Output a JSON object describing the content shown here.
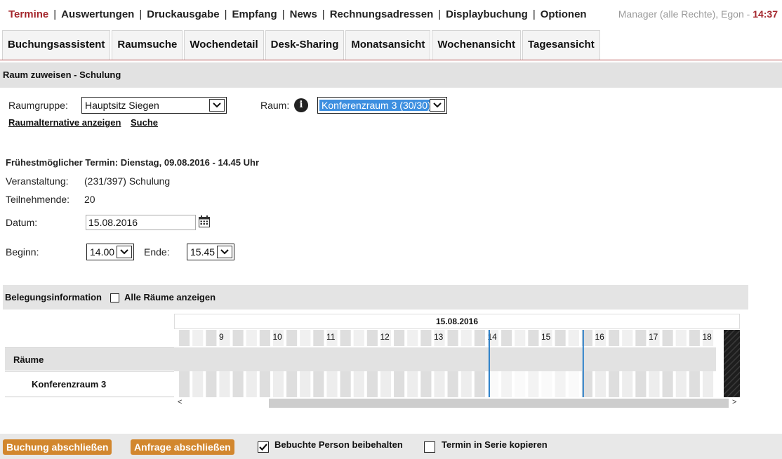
{
  "topnav": {
    "items": [
      "Termine",
      "Auswertungen",
      "Druckausgabe",
      "Empfang",
      "News",
      "Rechnungsadressen",
      "Displaybuchung",
      "Optionen"
    ],
    "user": "Manager (alle Rechte), Egon - ",
    "time": "14:37"
  },
  "tabs": [
    "Buchungsassistent",
    "Raumsuche",
    "Wochendetail",
    "Desk-Sharing",
    "Monatsansicht",
    "Wochenansicht",
    "Tagesansicht"
  ],
  "section": {
    "title": "Raum zuweisen - Schulung"
  },
  "form": {
    "raumgruppe_label": "Raumgruppe:",
    "raumgruppe_value": "Hauptsitz Siegen",
    "raum_label": "Raum:",
    "raum_value": "Konferenzraum 3 (30/30)",
    "raumalternative_link": "Raumalternative anzeigen",
    "suche_link": "Suche",
    "earliest": "Frühestmöglicher Termin: Dienstag, 09.08.2016 - 14.45 Uhr",
    "veranstaltung_label": "Veranstaltung:",
    "veranstaltung_value": "(231/397) Schulung",
    "teilnehmende_label": "Teilnehmende:",
    "teilnehmende_value": "20",
    "datum_label": "Datum:",
    "datum_value": "15.08.2016",
    "beginn_label": "Beginn:",
    "beginn_value": "14.00",
    "ende_label": "Ende:",
    "ende_value": "15.45"
  },
  "belegung": {
    "title": "Belegungsinformation",
    "alle_raeume_label": "Alle Räume anzeigen",
    "alle_raeume_checked": false,
    "date": "15.08.2016",
    "hours": [
      "9",
      "10",
      "11",
      "12",
      "13",
      "14",
      "15",
      "16",
      "17",
      "18"
    ],
    "rooms_header": "Räume",
    "room": "Konferenzraum 3",
    "booking_start": "14.00",
    "booking_end": "15.45"
  },
  "footer": {
    "buchung_button": "Buchung abschließen",
    "anfrage_button": "Anfrage abschließen",
    "bebuchte_label": "Bebuchte Person beibehalten",
    "bebuchte_checked": true,
    "serie_label": "Termin in Serie kopieren",
    "serie_checked": false
  },
  "colors": {
    "accent": "#a4262c",
    "button": "#d2872e",
    "selection": "#3d8fe0",
    "marker": "#2a7fc9"
  }
}
